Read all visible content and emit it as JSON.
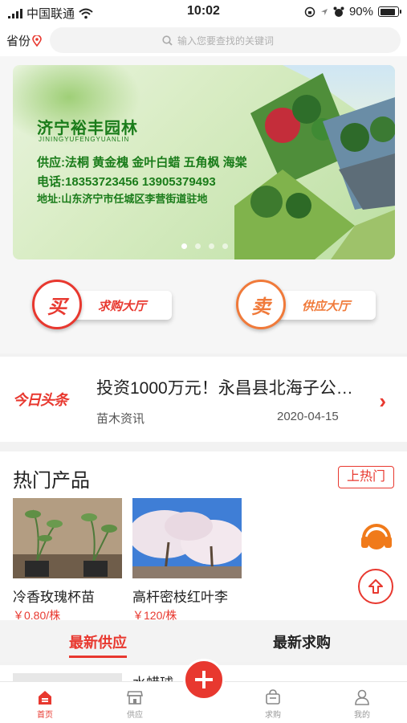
{
  "status_bar": {
    "carrier": "中国联通",
    "time": "10:02",
    "battery": "90%",
    "battery_level": 0.9
  },
  "header": {
    "province_label": "省份",
    "search_placeholder": "输入您要查找的关键词"
  },
  "banner": {
    "title": "济宁裕丰园林",
    "pinyin": "JININGYUFENGYUANLIN",
    "supply_line": "供应:法桐 黄金槐 金叶白蜡 五角枫 海棠",
    "phone_line": "电话:18353723456  13905379493",
    "address_line": "地址:山东济宁市任城区李营街道驻地",
    "slides_total": 4,
    "active_slide": 1
  },
  "actions": {
    "buy": {
      "glyph": "买",
      "label": "求购大厅"
    },
    "sell": {
      "glyph": "卖",
      "label": "供应大厅"
    }
  },
  "news": {
    "logo": "今日头条",
    "headline": "投资1000万元！永昌县北海子公园...",
    "category": "苗木资讯",
    "date": "2020-04-15"
  },
  "hot": {
    "title": "热门产品",
    "up_button": "上热门",
    "products": [
      {
        "name": "冷香玫瑰杯苗",
        "price": "￥0.80/株"
      },
      {
        "name": "高杆密枝红叶李",
        "price": "￥120/株"
      }
    ]
  },
  "tabs": {
    "supply": "最新供应",
    "demand": "最新求购"
  },
  "partial_item": {
    "text": "水蜡球"
  },
  "bottom_nav": {
    "home": "首页",
    "supply": "供应",
    "demand": "求购",
    "mine": "我的"
  },
  "colors": {
    "accent": "#e8382f",
    "orange": "#f07a3a",
    "banner_green": "#1a7c1a"
  }
}
